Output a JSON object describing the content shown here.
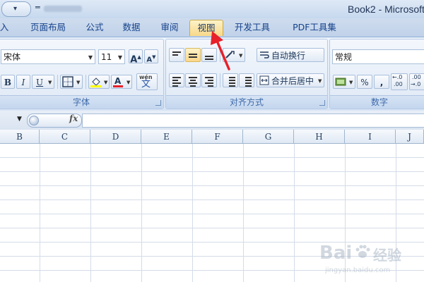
{
  "window": {
    "title": "Book2 - Microsoft"
  },
  "quick_access": {
    "menu_arrow": "▾"
  },
  "tabs": [
    {
      "label": "插入",
      "visible_text": "入"
    },
    {
      "label": "页面布局"
    },
    {
      "label": "公式"
    },
    {
      "label": "数据"
    },
    {
      "label": "审阅"
    },
    {
      "label": "视图",
      "active": true
    },
    {
      "label": "开发工具"
    },
    {
      "label": "PDF工具集"
    }
  ],
  "font_group": {
    "label": "字体",
    "font_name": "宋体",
    "font_size": "11",
    "grow_font": "A",
    "shrink_font": "A",
    "bold": "B",
    "italic": "I",
    "underline": "U",
    "font_color_letter": "A",
    "phonetic_top": "wén",
    "phonetic_bottom": "文"
  },
  "align_group": {
    "label": "对齐方式",
    "wrap_text": "自动换行",
    "merge_center": "合并后居中"
  },
  "number_group": {
    "label": "数字",
    "format": "常规",
    "percent": "%",
    "comma": ",",
    "inc_decimal_top": "←.0",
    "inc_decimal_bottom": ".00",
    "dec_decimal_top": ".00",
    "dec_decimal_bottom": "→.0"
  },
  "formula_bar": {
    "fx": "fx",
    "value": ""
  },
  "columns": [
    "B",
    "C",
    "D",
    "E",
    "F",
    "G",
    "H",
    "I",
    "J"
  ],
  "colors": {
    "accent": "#15428b",
    "active_tab": "#f7d88a",
    "annotation_arrow": "#e8202a",
    "font_color_bar": "#e8202a",
    "fill_color_bar": "#ffff00"
  },
  "watermark": {
    "main": "Bai",
    "cn": "经验",
    "sub": "jingyan.baidu.com"
  }
}
